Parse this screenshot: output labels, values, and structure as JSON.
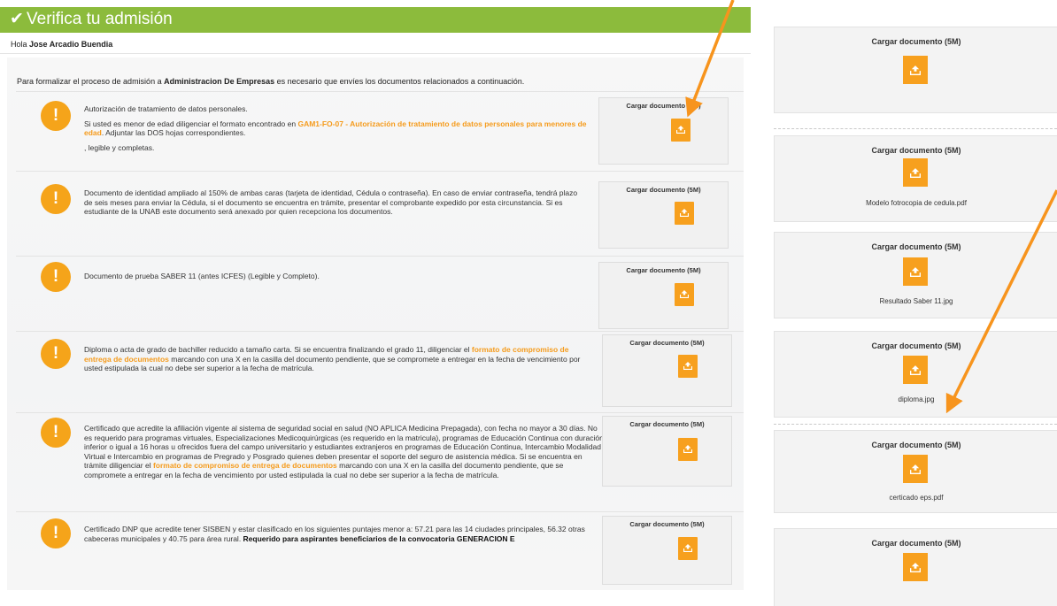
{
  "header": {
    "check_icon": "✔",
    "title": "Verifica tu admisión",
    "greeting_prefix": "Hola",
    "user_name": "Jose Arcadio Buendia"
  },
  "intro": {
    "before": "Para formalizar el proceso de admisión a ",
    "program": "Administracion De Empresas",
    "after": " es necesario que envíes los documentos relacionados a continuación."
  },
  "upload_label": "Cargar documento (5M)",
  "warning_glyph": "!",
  "requirements": [
    {
      "p1": "Autorización de tratamiento de datos personales.",
      "p2_a": "Si usted es menor de edad diligenciar el formato encontrado en ",
      "p2_link": "GAM1-FO-07 - Autorización de tratamiento de datos personales para menores de edad",
      "p2_b": ". Adjuntar las DOS hojas correspondientes.",
      "p3": ", legible y completas."
    },
    {
      "text": "Documento de identidad ampliado al 150% de ambas caras (tarjeta de identidad, Cédula o contraseña). En caso de enviar contraseña, tendrá plazo de seis meses para enviar la Cédula, si el documento se encuentra en trámite, presentar el comprobante expedido por esta circunstancia. Si es estudiante de la UNAB este documento será anexado por quien recepciona los documentos."
    },
    {
      "text": "Documento de prueba SABER 11 (antes ICFES) (Legible y Completo)."
    },
    {
      "a": "Diploma o acta de grado de bachiller reducido a tamaño carta. Si se encuentra finalizando el grado 11, diligenciar el ",
      "link": "formato de compromiso de entrega de documentos",
      "b": " marcando con una X en la casilla del documento pendiente, que se compromete a entregar en la fecha de vencimiento por usted estipulada la cual no debe ser superior a la fecha de matrícula."
    },
    {
      "a": "Certificado que acredite la afiliación vigente al sistema de seguridad social en salud (NO APLICA Medicina Prepagada), con fecha no mayor a 30 días. No es requerido para programas virtuales, Especializaciones Medicoquirúrgicas (es requerido en la matricula), programas de Educación Continua con duración inferior o igual a 16 horas u ofrecidos fuera del campo universitario y estudiantes extranjeros en programas de Educación Continua, Intercambio Modalidad Virtual e Intercambio en programas de Pregrado y Posgrado quienes deben presentar el soporte del seguro de asistencia médica. Si se encuentra en trámite diligenciar el ",
      "link": "formato de compromiso de entrega de documentos",
      "b": " marcando con una X en la casilla del documento pendiente, que se compromete a entregar en la fecha de vencimiento por usted estipulada la cual no debe ser superior a la fecha de matrícula."
    },
    {
      "a": "Certificado DNP que acredite tener SISBEN y estar clasificado en los siguientes puntajes menor a: 57.21 para las 14 ciudades principales, 56.32 otras cabeceras municipales y 40.75 para área rural. ",
      "bold": "Requerido para aspirantes beneficiarios de la convocatoria GENERACION E"
    }
  ],
  "uploaded_panel": {
    "upload_label": "Cargar documento (5M)",
    "files": [
      "",
      "Modelo fotrocopia de cedula.pdf",
      "Resultado Saber 11.jpg",
      "diploma.jpg",
      "certicado eps.pdf",
      ""
    ]
  },
  "colors": {
    "header_green": "#8cbb3c",
    "accent_orange": "#f7a01e",
    "warning_orange": "#f5a41a",
    "link_orange": "#f59b1c"
  }
}
